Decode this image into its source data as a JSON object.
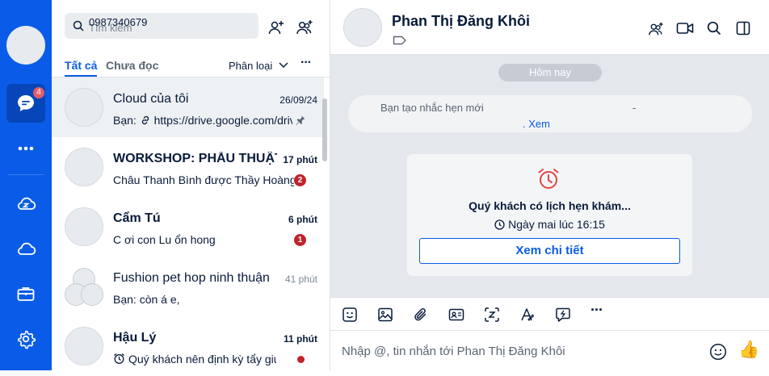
{
  "rail": {
    "messages_badge": "4",
    "accent": "#0a5ce8"
  },
  "search": {
    "value": "0987340679",
    "placeholder": "Tìm kiếm"
  },
  "tabs": {
    "all": "Tất cả",
    "unread": "Chưa đọc",
    "filter": "Phân loại",
    "more": "···"
  },
  "conversations": [
    {
      "name": "Cloud của tôi",
      "time": "26/09/24",
      "preview": "Bạn:  https://drive.google.com/drive/folders",
      "pinned": true
    },
    {
      "name": "WORKSHOP: PHẪU THUẬT TỔNG QUÁT",
      "time": "17 phút",
      "preview": "Châu Thanh Bình được Thầy Hoàng thêm vào nhóm",
      "badge": "2"
    },
    {
      "name": "Cẩm Tú",
      "time": "6 phút",
      "preview": "C ơi con Lu ổn hong",
      "badge": "1"
    },
    {
      "name": "Fushion pet hop ninh thuận",
      "time": "41 phút",
      "preview": "Bạn: còn á e,"
    },
    {
      "name": "Hậu Lý",
      "time": "11 phút",
      "preview": "Quý khách nên định kỳ tẩy giun cho thú cưng",
      "unread_dot": true
    }
  ],
  "chat": {
    "name": "Phan Thị Đăng Khôi",
    "date_pill": "Hôm nay",
    "system_text": "Bạn tạo nhắc hẹn mới",
    "system_dash": "-",
    "system_link": ". Xem",
    "card_title": "Quý khách có lịch hẹn khám...",
    "card_time": "Ngày mai lúc 16:15",
    "card_button": "Xem chi tiết",
    "input_placeholder": "Nhập @, tin nhắn tới Phan Thị Đăng Khôi",
    "toolbar_more": "···",
    "like_emoji": "👍"
  }
}
